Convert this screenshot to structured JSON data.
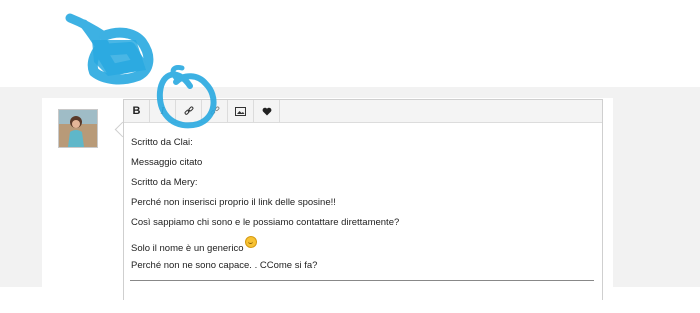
{
  "toolbar": {
    "bold_label": "B",
    "italic_label": "I"
  },
  "post": {
    "lines": [
      "Scritto da Clai:",
      "Messaggio citato",
      "Scritto da Mery:",
      "Perché non inserisci proprio il link delle sposine!!",
      "Così sappiamo chi sono e le possiamo contattare direttamente?",
      "Solo il nome è un generico",
      "Perché non ne sono capace. . CCome si fa?"
    ]
  },
  "colors": {
    "annotation": "#29a9e1",
    "band": "#f2f2f2"
  },
  "icons": [
    "bold",
    "italic",
    "link-icon",
    "unlink-icon",
    "image-icon",
    "heart-icon",
    "smiley-icon"
  ]
}
